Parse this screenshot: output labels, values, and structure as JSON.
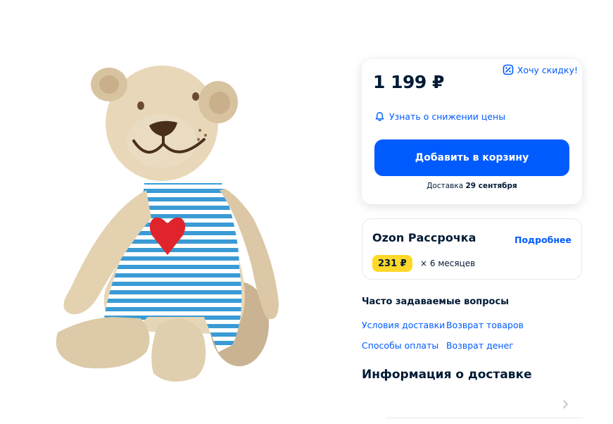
{
  "product": {
    "image_alt": "bear-plush-toy"
  },
  "price_card": {
    "price": "1 199 ₽",
    "discount_link": "Хочу скидку!",
    "notify_link": "Узнать о снижении цены",
    "cart_button": "Добавить в корзину",
    "delivery_prefix": "Доставка",
    "delivery_date": "29 сентября"
  },
  "installment": {
    "title": "Ozon Рассрочка",
    "more_link": "Подробнее",
    "amount": "231 ₽",
    "term": "× 6 месяцев"
  },
  "faq": {
    "title": "Часто задаваемые вопросы",
    "links": [
      "Условия доставки",
      "Возврат товаров",
      "Способы оплаты",
      "Возврат денег"
    ]
  },
  "delivery_info": {
    "title": "Информация о доставке"
  },
  "colors": {
    "accent": "#005bff",
    "text": "#001a34",
    "badge": "#ffd829"
  },
  "icons": [
    "discount-tag-icon",
    "bell-icon",
    "chevron-right-icon"
  ]
}
